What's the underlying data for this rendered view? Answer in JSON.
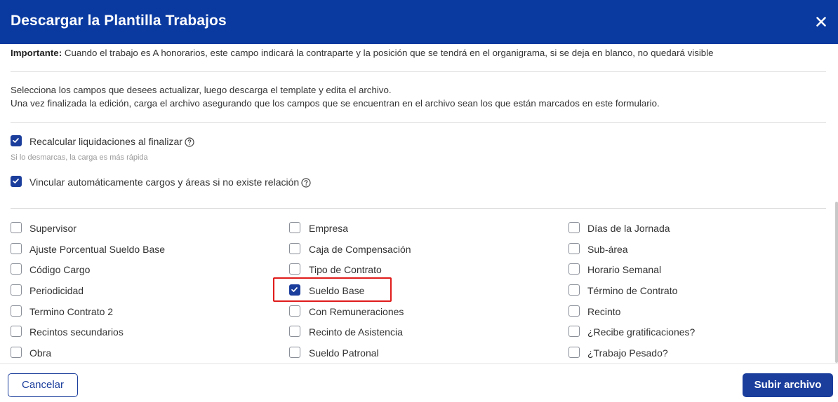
{
  "dialog": {
    "title": "Descargar la Plantilla Trabajos"
  },
  "notice": {
    "important_label": "Importante:",
    "important_text": " Cuando el trabajo es A honorarios, este campo indicará la contraparte y la posición que se tendrá en el organigrama, si se deja en blanco, no quedará visible"
  },
  "instructions": {
    "line1": "Selecciona los campos que desees actualizar, luego descarga el template y edita el archivo.",
    "line2": "Una vez finalizada la edición, carga el archivo asegurando que los campos que se encuentran en el archivo sean los que están marcados en este formulario."
  },
  "options": {
    "recalcular": {
      "label": "Recalcular liquidaciones al finalizar",
      "checked": true,
      "hint": "Si lo desmarcas, la carga es más rápida"
    },
    "vincular": {
      "label": "Vincular automáticamente cargos y áreas si no existe relación",
      "checked": true
    }
  },
  "fields": {
    "col1": [
      {
        "label": "Supervisor",
        "checked": false
      },
      {
        "label": "Ajuste Porcentual Sueldo Base",
        "checked": false
      },
      {
        "label": "Código Cargo",
        "checked": false
      },
      {
        "label": "Periodicidad",
        "checked": false
      },
      {
        "label": "Termino Contrato 2",
        "checked": false
      },
      {
        "label": "Recintos secundarios",
        "checked": false
      },
      {
        "label": "Obra",
        "checked": false
      }
    ],
    "col2": [
      {
        "label": "Empresa",
        "checked": false
      },
      {
        "label": "Caja de Compensación",
        "checked": false
      },
      {
        "label": "Tipo de Contrato",
        "checked": false
      },
      {
        "label": "Sueldo Base",
        "checked": true
      },
      {
        "label": "Con Remuneraciones",
        "checked": false
      },
      {
        "label": "Recinto de Asistencia",
        "checked": false
      },
      {
        "label": "Sueldo Patronal",
        "checked": false
      }
    ],
    "col3": [
      {
        "label": "Días de la Jornada",
        "checked": false
      },
      {
        "label": "Sub-área",
        "checked": false
      },
      {
        "label": "Horario Semanal",
        "checked": false
      },
      {
        "label": "Término de Contrato",
        "checked": false
      },
      {
        "label": "Recinto",
        "checked": false
      },
      {
        "label": "¿Recibe gratificaciones?",
        "checked": false
      },
      {
        "label": "¿Trabajo Pesado?",
        "checked": false
      }
    ]
  },
  "footer": {
    "cancel_label": "Cancelar",
    "upload_label": "Subir archivo"
  },
  "colors": {
    "header_bg": "#0a3aa0",
    "accent": "#1b3e9c",
    "highlight": "#e01b1b"
  },
  "icons": {
    "close": "close-icon",
    "help": "help-circle-icon",
    "check": "checkmark-icon"
  }
}
